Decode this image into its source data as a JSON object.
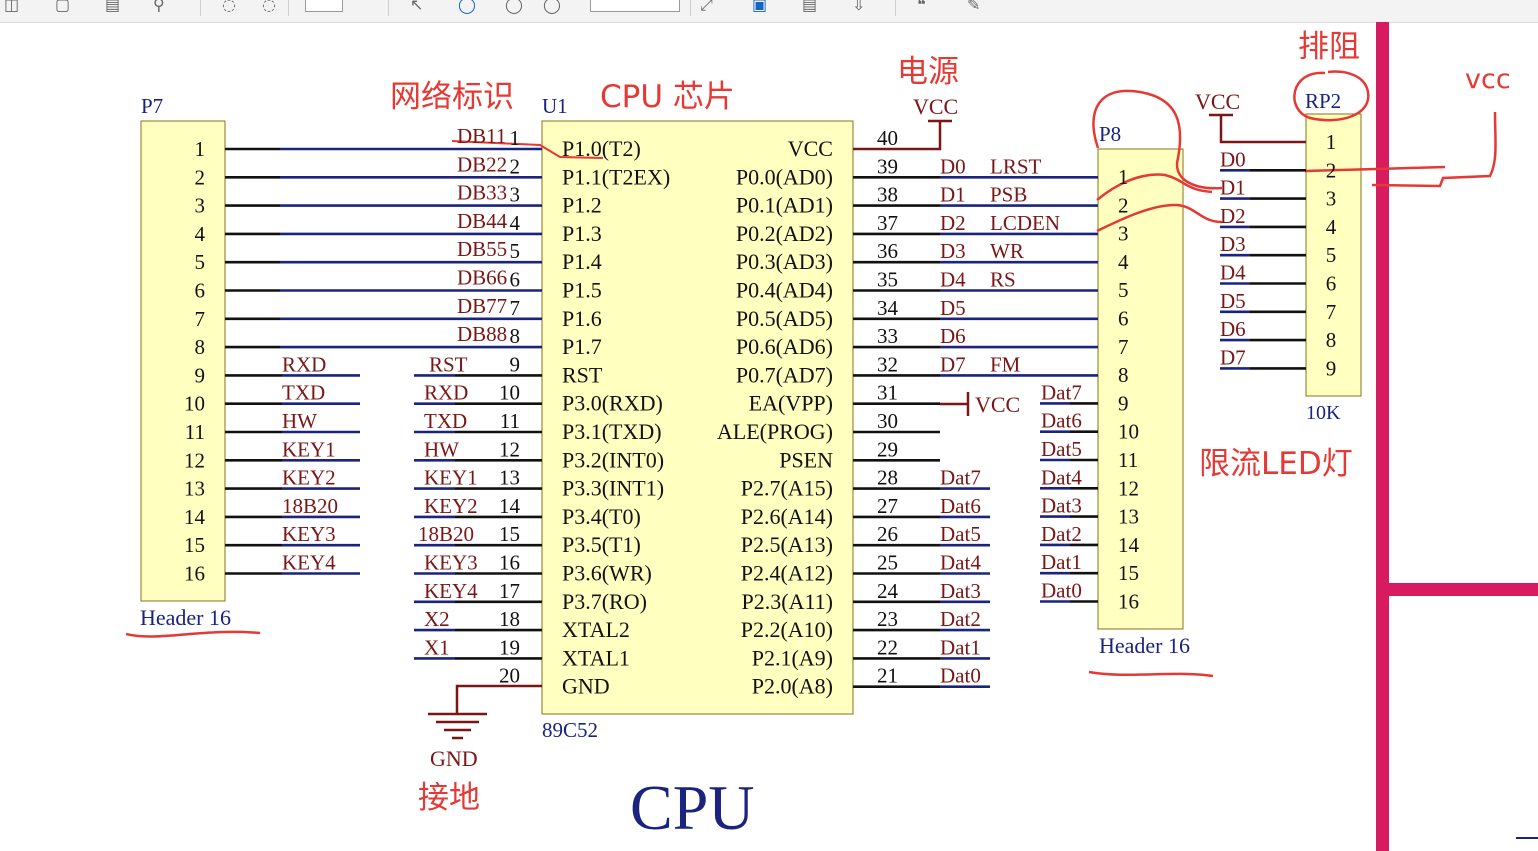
{
  "toolbar": {
    "page_input": "",
    "zoom_input": ""
  },
  "annotations": {
    "net_label": "网络标识",
    "cpu_chip": "CPU  芯片",
    "power": "电源",
    "ground": "接地",
    "resistor_array": "排阻",
    "led_limit": "限流LED灯",
    "vcc_hand": "vcc"
  },
  "title": "CPU",
  "p7": {
    "ref": "P7",
    "name": "Header 16",
    "pins": [
      "1",
      "2",
      "3",
      "4",
      "5",
      "6",
      "7",
      "8",
      "9",
      "10",
      "11",
      "12",
      "13",
      "14",
      "15",
      "16"
    ],
    "nets": [
      "",
      "",
      "",
      "",
      "",
      "",
      "",
      "",
      "RXD",
      "TXD",
      "HW",
      "KEY1",
      "KEY2",
      "18B20",
      "KEY3",
      "KEY4"
    ]
  },
  "u1": {
    "ref": "U1",
    "part": "89C52",
    "left_pins": [
      {
        "num": "1",
        "name": "P1.0(T2)",
        "net": "DB11"
      },
      {
        "num": "2",
        "name": "P1.1(T2EX)",
        "net": "DB22"
      },
      {
        "num": "3",
        "name": "P1.2",
        "net": "DB33"
      },
      {
        "num": "4",
        "name": "P1.3",
        "net": "DB44"
      },
      {
        "num": "5",
        "name": "P1.4",
        "net": "DB55"
      },
      {
        "num": "6",
        "name": "P1.5",
        "net": "DB66"
      },
      {
        "num": "7",
        "name": "P1.6",
        "net": "DB77"
      },
      {
        "num": "8",
        "name": "P1.7",
        "net": "DB88"
      },
      {
        "num": "9",
        "name": "RST",
        "net": "RST"
      },
      {
        "num": "10",
        "name": "P3.0(RXD)",
        "net": "RXD"
      },
      {
        "num": "11",
        "name": "P3.1(TXD)",
        "net": "TXD"
      },
      {
        "num": "12",
        "name": "P3.2(INT0)",
        "net": "HW"
      },
      {
        "num": "13",
        "name": "P3.3(INT1)",
        "net": "KEY1"
      },
      {
        "num": "14",
        "name": "P3.4(T0)",
        "net": "KEY2"
      },
      {
        "num": "15",
        "name": "P3.5(T1)",
        "net": "18B20"
      },
      {
        "num": "16",
        "name": "P3.6(WR)",
        "net": "KEY3"
      },
      {
        "num": "17",
        "name": "P3.7(RO)",
        "net": "KEY4"
      },
      {
        "num": "18",
        "name": "XTAL2",
        "net": "X2"
      },
      {
        "num": "19",
        "name": "XTAL1",
        "net": "X1"
      },
      {
        "num": "20",
        "name": "GND",
        "net": ""
      }
    ],
    "right_pins": [
      {
        "num": "40",
        "name": "VCC",
        "net": "",
        "net2": ""
      },
      {
        "num": "39",
        "name": "P0.0(AD0)",
        "net": "D0",
        "net2": "LRST"
      },
      {
        "num": "38",
        "name": "P0.1(AD1)",
        "net": "D1",
        "net2": "PSB"
      },
      {
        "num": "37",
        "name": "P0.2(AD2)",
        "net": "D2",
        "net2": "LCDEN"
      },
      {
        "num": "36",
        "name": "P0.3(AD3)",
        "net": "D3",
        "net2": "WR"
      },
      {
        "num": "35",
        "name": "P0.4(AD4)",
        "net": "D4",
        "net2": "RS"
      },
      {
        "num": "34",
        "name": "P0.5(AD5)",
        "net": "D5",
        "net2": ""
      },
      {
        "num": "33",
        "name": "P0.6(AD6)",
        "net": "D6",
        "net2": ""
      },
      {
        "num": "32",
        "name": "P0.7(AD7)",
        "net": "D7",
        "net2": "FM"
      },
      {
        "num": "31",
        "name": "EA(VPP)",
        "net": "",
        "net2": ""
      },
      {
        "num": "30",
        "name": "ALE(PROG)",
        "net": "",
        "net2": ""
      },
      {
        "num": "29",
        "name": "PSEN",
        "net": "",
        "net2": ""
      },
      {
        "num": "28",
        "name": "P2.7(A15)",
        "net": "Dat7",
        "net2": ""
      },
      {
        "num": "27",
        "name": "P2.6(A14)",
        "net": "Dat6",
        "net2": ""
      },
      {
        "num": "26",
        "name": "P2.5(A13)",
        "net": "Dat5",
        "net2": ""
      },
      {
        "num": "25",
        "name": "P2.4(A12)",
        "net": "Dat4",
        "net2": ""
      },
      {
        "num": "24",
        "name": "P2.3(A11)",
        "net": "Dat3",
        "net2": ""
      },
      {
        "num": "23",
        "name": "P2.2(A10)",
        "net": "Dat2",
        "net2": ""
      },
      {
        "num": "22",
        "name": "P2.1(A9)",
        "net": "Dat1",
        "net2": ""
      },
      {
        "num": "21",
        "name": "P2.0(A8)",
        "net": "Dat0",
        "net2": ""
      }
    ]
  },
  "vcc_labels": [
    "VCC",
    "VCC",
    "VCC"
  ],
  "gnd_label": "GND",
  "p8": {
    "ref": "P8",
    "name": "Header 16",
    "pins": [
      "1",
      "2",
      "3",
      "4",
      "5",
      "6",
      "7",
      "8",
      "9",
      "10",
      "11",
      "12",
      "13",
      "14",
      "15",
      "16"
    ],
    "nets": [
      "",
      "",
      "",
      "",
      "",
      "",
      "",
      "",
      "Dat7",
      "Dat6",
      "Dat5",
      "Dat4",
      "Dat3",
      "Dat2",
      "Dat1",
      "Dat0"
    ]
  },
  "rp2": {
    "ref": "RP2",
    "value": "10K",
    "pins": [
      "1",
      "2",
      "3",
      "4",
      "5",
      "6",
      "7",
      "8",
      "9"
    ],
    "nets": [
      "",
      "D0",
      "D1",
      "D2",
      "D3",
      "D4",
      "D5",
      "D6",
      "D7"
    ]
  },
  "colors": {
    "component_fill": "#ffffc0",
    "component_border": "#8b6f1e",
    "wire_dark": "#111111",
    "wire_blue": "#1a237e",
    "net_label": "#7a1616",
    "annotation_red": "#e53935",
    "border_magenta": "#d81b60"
  },
  "icons": [
    "pin-icon",
    "open-icon",
    "save-icon",
    "search-icon",
    "nav-prev-icon",
    "nav-next-icon",
    "cursor-icon",
    "zoom-circle-icon",
    "zoom-out-icon",
    "zoom-in-icon",
    "fit-icon",
    "page-icon",
    "rotate-icon",
    "hand-icon",
    "comment-icon",
    "sign-icon"
  ]
}
